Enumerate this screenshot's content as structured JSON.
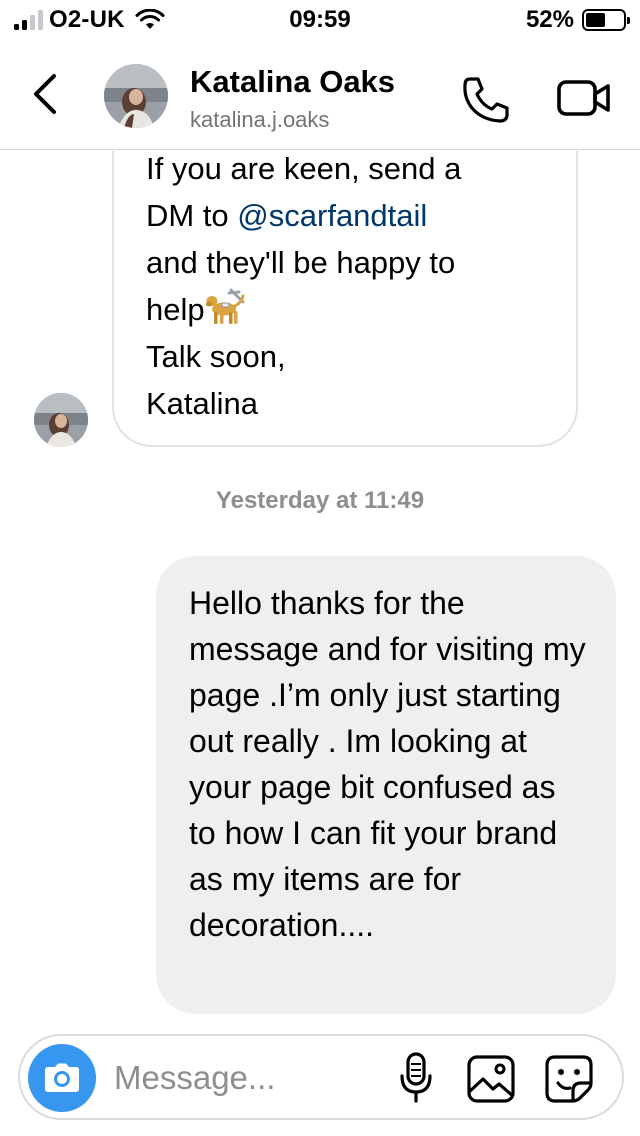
{
  "status_bar": {
    "carrier": "O2-UK",
    "time": "09:59",
    "battery_percent": "52%",
    "battery_level": 0.52,
    "signal_bars": 2
  },
  "header": {
    "name": "Katalina Oaks",
    "handle": "katalina.j.oaks",
    "icons": [
      "chevron-left-icon",
      "phone-icon",
      "video-camera-icon"
    ]
  },
  "messages": {
    "incoming": {
      "line1": "If you are keen, send a",
      "line2_prefix": "DM to ",
      "mention": "@scarfandtail",
      "line3": "and they'll be happy to",
      "line4": "help",
      "line5": "Talk soon,",
      "line6": "Katalina"
    },
    "timestamp": "Yesterday at 11:49",
    "outgoing": {
      "text": "Hello thanks for the message and for visiting my page .I’m only just starting out really . Im looking at your page bit confused as to how I can fit your brand as my items are for decoration...."
    }
  },
  "composer": {
    "placeholder": "Message...",
    "icons": [
      "camera-icon",
      "microphone-icon",
      "gallery-icon",
      "sticker-icon"
    ]
  },
  "colors": {
    "accent": "#3797f0",
    "mention": "#00376b",
    "outgoing_bubble": "#efefef",
    "muted_text": "#8e8e8e"
  }
}
